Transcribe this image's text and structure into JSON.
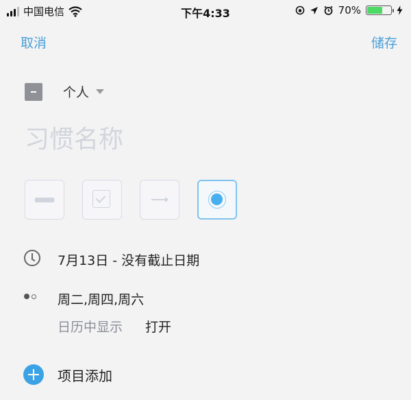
{
  "status_bar": {
    "carrier": "中国电信",
    "time": "下午4:33",
    "battery": "70%",
    "battery_level": 0.7
  },
  "nav": {
    "cancel_label": "取消",
    "save_label": "储存"
  },
  "group": {
    "label": "个人"
  },
  "habit_name": {
    "value": "",
    "placeholder": "习惯名称"
  },
  "habit_types": {
    "icons": [
      "bar-icon",
      "checkbox-icon",
      "arrow-icon",
      "radio-icon"
    ],
    "selected_index": 3
  },
  "schedule": {
    "date_range": "7月13日 - 没有截止日期",
    "repeat_days": "周二,周四,周六",
    "calendar_label": "日历中显示",
    "calendar_value": "打开"
  },
  "add_item": {
    "label": "项目添加"
  },
  "colors": {
    "accent": "#4a9fd6",
    "add_button": "#3ba2e6",
    "selected_radio": "#47aef0",
    "battery_fill": "#4cd964"
  }
}
